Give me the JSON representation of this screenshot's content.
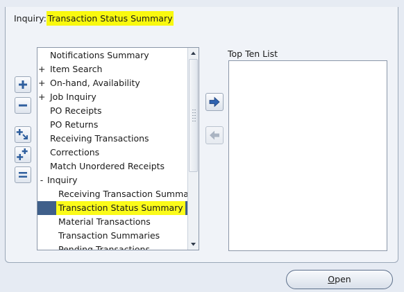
{
  "inquiry": {
    "prefix": "Inquiry:",
    "title": "Transaction Status Summary"
  },
  "tree_items": [
    {
      "label": "Notifications Summary",
      "expander": "",
      "indent": 0,
      "selected": false
    },
    {
      "label": "Item Search",
      "expander": "+",
      "indent": 0,
      "selected": false
    },
    {
      "label": "On-hand, Availability",
      "expander": "+",
      "indent": 0,
      "selected": false
    },
    {
      "label": "Job Inquiry",
      "expander": "+",
      "indent": 0,
      "selected": false
    },
    {
      "label": "PO Receipts",
      "expander": "",
      "indent": 0,
      "selected": false
    },
    {
      "label": "PO Returns",
      "expander": "",
      "indent": 0,
      "selected": false
    },
    {
      "label": "Receiving Transactions",
      "expander": "",
      "indent": 0,
      "selected": false
    },
    {
      "label": "Corrections",
      "expander": "",
      "indent": 0,
      "selected": false
    },
    {
      "label": "Match Unordered Receipts",
      "expander": "",
      "indent": 0,
      "selected": false
    },
    {
      "label": "Inquiry",
      "expander": "-",
      "indent": 0,
      "selected": false
    },
    {
      "label": "Receiving Transaction Summary",
      "expander": "",
      "indent": 1,
      "selected": false
    },
    {
      "label": "Transaction Status Summary",
      "expander": "",
      "indent": 1,
      "selected": true
    },
    {
      "label": "Material Transactions",
      "expander": "",
      "indent": 1,
      "selected": false
    },
    {
      "label": "Transaction Summaries",
      "expander": "",
      "indent": 1,
      "selected": false
    },
    {
      "label": "Pending Transactions",
      "expander": "",
      "indent": 1,
      "selected": false
    }
  ],
  "left_buttons": [
    "expand-icon",
    "collapse-icon",
    "expand-branch-icon",
    "expand-all-icon",
    "collapse-all-icon"
  ],
  "middle_buttons": [
    "add-right-arrow-icon",
    "remove-left-arrow-icon"
  ],
  "top_ten": {
    "label": "Top Ten List",
    "items": []
  },
  "open_button": {
    "mnemonic": "O",
    "rest": "pen"
  },
  "colors": {
    "highlight": "#fbfb1a",
    "selection": "#3f5f8a",
    "panel": "#f0f3f8",
    "background": "#e6ebf3"
  }
}
